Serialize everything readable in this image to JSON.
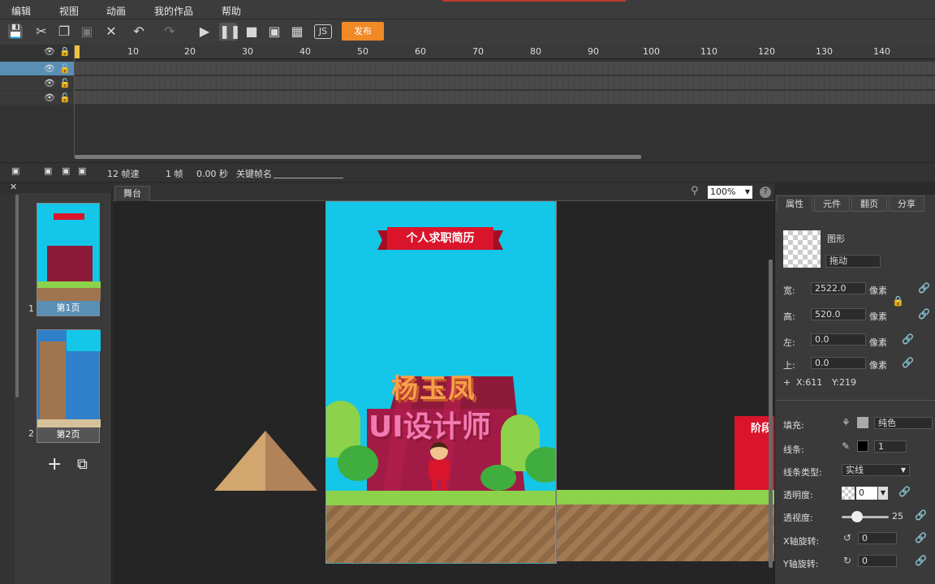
{
  "menu": [
    "编辑",
    "视图",
    "动画",
    "我的作品",
    "帮助"
  ],
  "toolbar": {
    "publish_label": "发布"
  },
  "timeline": {
    "ticks": [
      "10",
      "20",
      "30",
      "40",
      "50",
      "60",
      "70",
      "80",
      "90",
      "100",
      "110",
      "120",
      "130",
      "140"
    ],
    "current_frame": "1"
  },
  "status": {
    "fps": "12 帧速",
    "frame": "1 帧",
    "seconds": "0.00 秒",
    "keyframe_label": "关键帧名"
  },
  "pages": [
    {
      "num": "1",
      "label": "第1页"
    },
    {
      "num": "2",
      "label": "第2页"
    }
  ],
  "stage": {
    "tab": "舞台",
    "zoom": "100%",
    "banner": "个人求职简历",
    "name": "杨玉凤",
    "title": "UI设计师",
    "right_sign": "阶段"
  },
  "props": {
    "tabs": [
      "属性",
      "元件",
      "翻页",
      "分享"
    ],
    "type": "图形",
    "drag": "拖动",
    "width_label": "宽:",
    "width": "2522.0",
    "height_label": "高:",
    "height": "520.0",
    "left_label": "左:",
    "left": "0.0",
    "top_label": "上:",
    "top": "0.0",
    "unit": "像素",
    "coord_x": "X:611",
    "coord_y": "Y:219",
    "fill_label": "填充:",
    "fill_mode": "纯色",
    "stroke_label": "线条:",
    "stroke_width": "1",
    "stroke_type_label": "线条类型:",
    "stroke_type": "实线",
    "opacity_label": "透明度:",
    "opacity": "0",
    "perspective_label": "透视度:",
    "perspective": "25",
    "xrot_label": "X轴旋转:",
    "xrot": "0",
    "yrot_label": "Y轴旋转:",
    "yrot": "0"
  },
  "colors": {
    "accent": "#f08a24",
    "sky": "#14c6e8",
    "banner": "#d9142b"
  }
}
